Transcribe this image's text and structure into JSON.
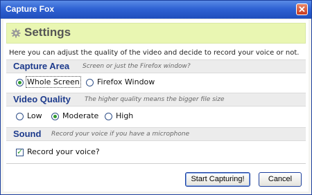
{
  "window": {
    "title": "Capture Fox",
    "close_glyph": "✕"
  },
  "header": {
    "title": "Settings",
    "icon": "gear-icon"
  },
  "intro": "Here you can adjust the quality of the video and decide to record your voice or not.",
  "capture_area": {
    "title": "Capture Area",
    "hint": "Screen or just the Firefox window?",
    "options": [
      "Whole Screen",
      "Firefox Window"
    ],
    "selected": "Whole Screen"
  },
  "video_quality": {
    "title": "Video Quality",
    "hint": "The higher quality means the bigger file size",
    "options": [
      "Low",
      "Moderate",
      "High"
    ],
    "selected": "Moderate"
  },
  "sound": {
    "title": "Sound",
    "hint": "Record your voice if you have a microphone",
    "checkbox_label": "Record your voice?",
    "checked": true
  },
  "buttons": {
    "start": "Start Capturing!",
    "cancel": "Cancel"
  },
  "colors": {
    "titlebar": "#2f62d3",
    "banner": "#e9f6b2",
    "section_title": "#1c3a8c",
    "radio_dot": "#2d9a2d"
  }
}
